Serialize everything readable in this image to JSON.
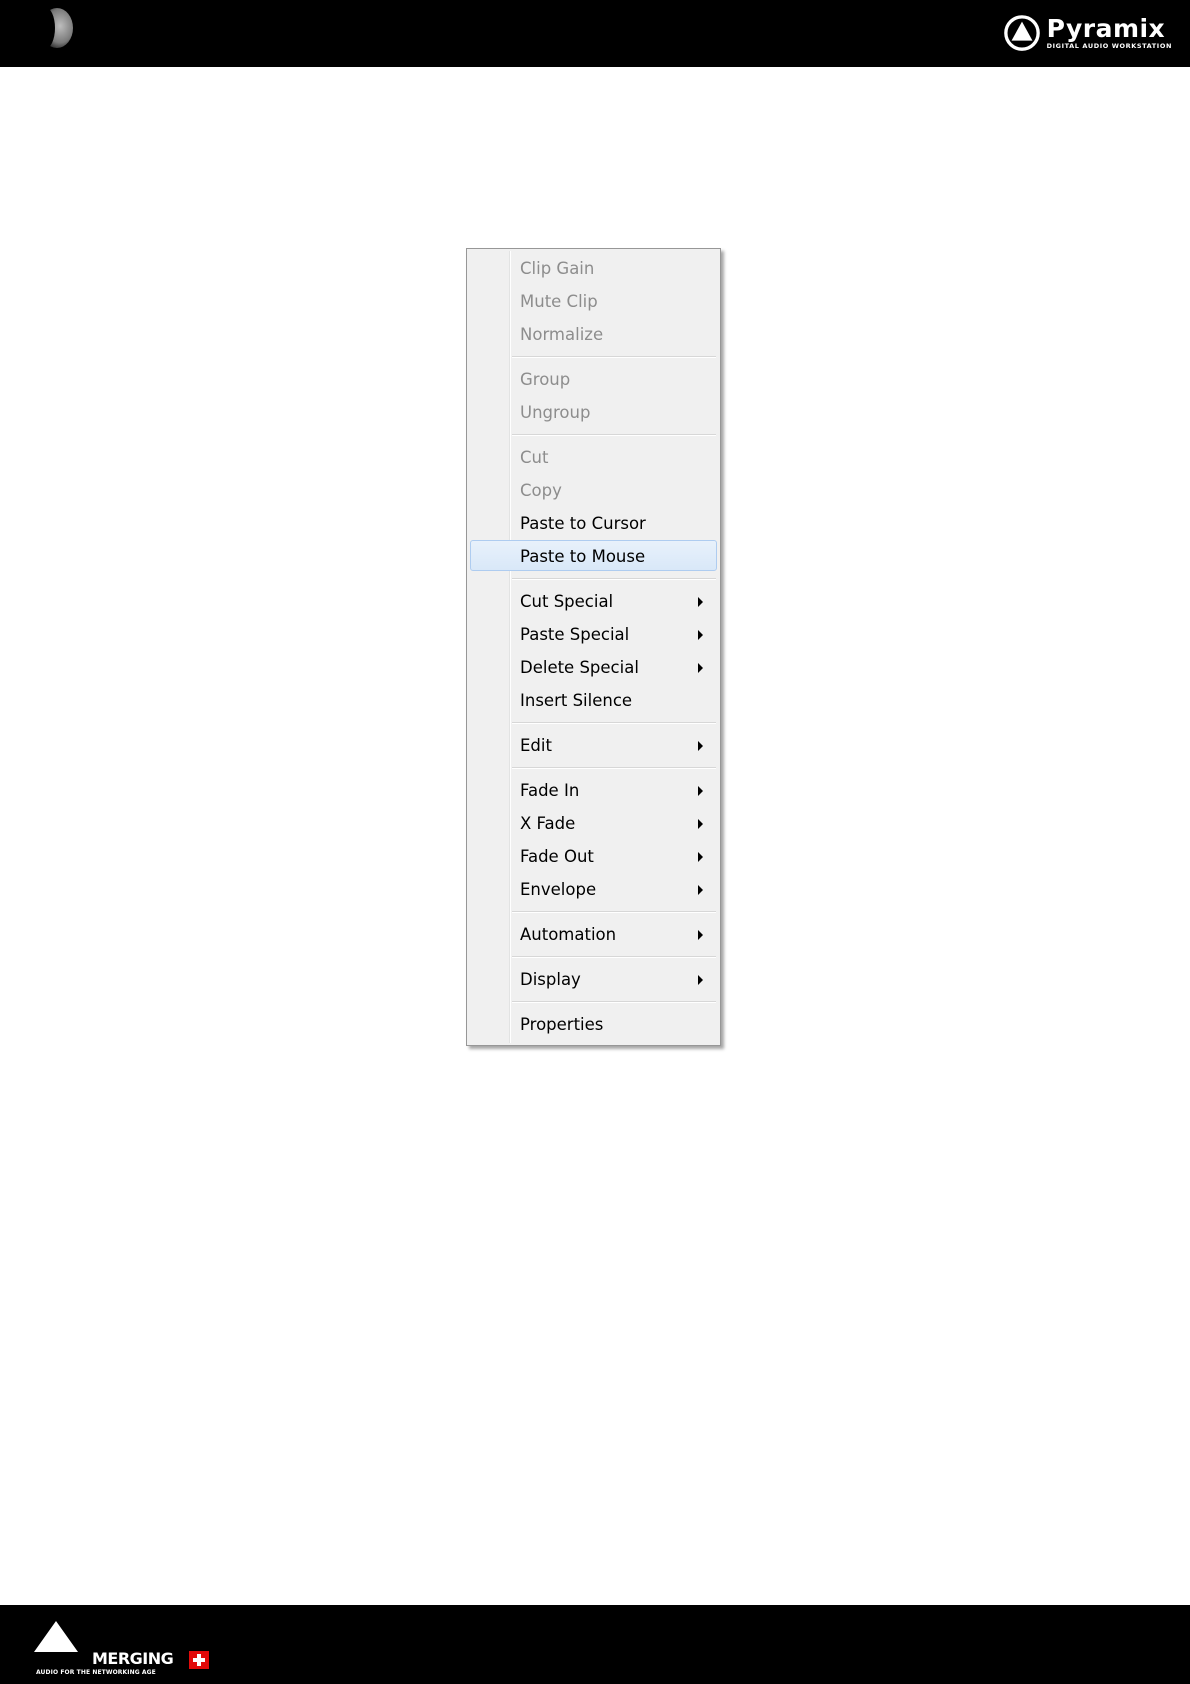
{
  "header": {
    "brand_name": "Pyramix",
    "brand_tagline": "DIGITAL AUDIO WORKSTATION"
  },
  "footer": {
    "company_name": "MERGING",
    "company_tagline": "AUDIO FOR THE NETWORKING AGE"
  },
  "menu": {
    "items": [
      {
        "label": "Clip Gain",
        "enabled": false,
        "submenu": false
      },
      {
        "label": "Mute Clip",
        "enabled": false,
        "submenu": false
      },
      {
        "label": "Normalize",
        "enabled": false,
        "submenu": false
      },
      {
        "label": "Group",
        "enabled": false,
        "submenu": false
      },
      {
        "label": "Ungroup",
        "enabled": false,
        "submenu": false
      },
      {
        "label": "Cut",
        "enabled": false,
        "submenu": false
      },
      {
        "label": "Copy",
        "enabled": false,
        "submenu": false
      },
      {
        "label": "Paste to Cursor",
        "enabled": true,
        "submenu": false
      },
      {
        "label": "Paste to Mouse",
        "enabled": true,
        "submenu": false,
        "highlighted": true
      },
      {
        "label": "Cut Special",
        "enabled": true,
        "submenu": true
      },
      {
        "label": "Paste Special",
        "enabled": true,
        "submenu": true
      },
      {
        "label": "Delete Special",
        "enabled": true,
        "submenu": true
      },
      {
        "label": "Insert Silence",
        "enabled": true,
        "submenu": false
      },
      {
        "label": "Edit",
        "enabled": true,
        "submenu": true
      },
      {
        "label": "Fade In",
        "enabled": true,
        "submenu": true
      },
      {
        "label": "X Fade",
        "enabled": true,
        "submenu": true
      },
      {
        "label": "Fade Out",
        "enabled": true,
        "submenu": true
      },
      {
        "label": "Envelope",
        "enabled": true,
        "submenu": true
      },
      {
        "label": "Automation",
        "enabled": true,
        "submenu": true
      },
      {
        "label": "Display",
        "enabled": true,
        "submenu": true
      },
      {
        "label": "Properties",
        "enabled": true,
        "submenu": false
      }
    ]
  },
  "colors": {
    "bar_background": "#000000",
    "menu_background": "#f0f0f0",
    "disabled_text": "#8d8d8d",
    "highlight_border": "#aeccf0",
    "flag_red": "#e10a0a"
  }
}
